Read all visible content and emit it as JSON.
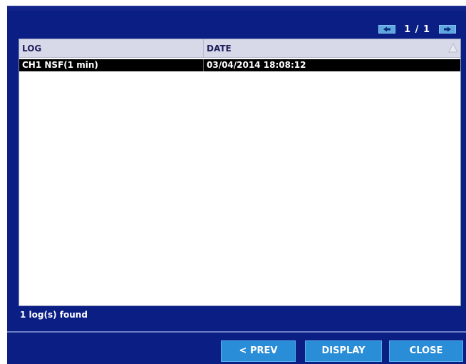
{
  "pager": {
    "page_indicator": "1 / 1",
    "prev_icon": "arrow-left-icon",
    "next_icon": "arrow-right-icon"
  },
  "list": {
    "columns": [
      "LOG",
      "DATE"
    ],
    "sort_icon": "sort-arrow-icon",
    "rows": [
      {
        "log": "CH1 NSF(1 min)",
        "date": "03/04/2014 18:08:12",
        "selected": true
      }
    ]
  },
  "status": {
    "text": "1 log(s) found"
  },
  "buttons": {
    "prev": "< PREV",
    "display": "DISPLAY",
    "close": "CLOSE"
  },
  "colors": {
    "background": "#0b1e84",
    "panel": "#ffffff",
    "header": "#d7d8e8",
    "selected_row": "#000000",
    "button": "#2a8dd8",
    "pager_button": "#5ea7e0"
  }
}
